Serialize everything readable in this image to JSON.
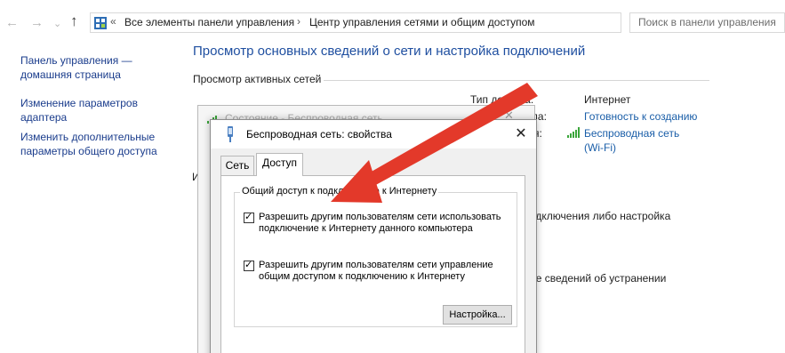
{
  "address_bar": {
    "back": "←",
    "forward": "→",
    "dropdown": "⌄",
    "up": "↑",
    "overflow": "«",
    "crumbs": [
      "Все элементы панели управления",
      "Центр управления сетями и общим доступом"
    ],
    "separator": "›",
    "search_placeholder": "Поиск в панели управления"
  },
  "sidebar": {
    "items": [
      "Панель управления — домашняя страница",
      "Изменение параметров адаптера",
      "Изменить дополнительные параметры общего доступа"
    ]
  },
  "main": {
    "title": "Просмотр основных сведений о сети и настройка подключений",
    "active_networks_header": "Просмотр активных сетей",
    "access_type_label": "Тип доступа:",
    "access_type_value": "Интернет",
    "homegroup_label": "группа:",
    "homegroup_value": "Готовность к созданию",
    "connections_label": "я:",
    "connection_value_line1": "Беспроводная сеть",
    "connection_value_line2": "(Wi-Fi)",
    "left_fragment": "И",
    "fragment_setup": "одключения либо настройка",
    "fragment_troubleshoot": "ие сведений об устранении"
  },
  "background_window": {
    "title": "Состояние - Беспроводная сеть"
  },
  "dialog": {
    "title": "Беспроводная сеть: свойства",
    "close": "✕",
    "tabs": [
      "Сеть",
      "Доступ"
    ],
    "active_tab": 1,
    "group_label": "Общий доступ к подключению к Интернету",
    "checkbox1_line1": "Разрешить другим пользователям сети использовать",
    "checkbox1_line2": "подключение к Интернету данного компьютера",
    "checkbox1_checked": true,
    "checkbox2_line1": "Разрешить другим пользователям сети управление",
    "checkbox2_line2": "общим доступом к подключению к Интернету",
    "checkbox2_checked": true,
    "settings_button": "Настройка...",
    "check_glyph": "✓"
  },
  "colors": {
    "link": "#1a5ea8",
    "title": "#1f4fa0",
    "arrow": "#e3392a"
  }
}
